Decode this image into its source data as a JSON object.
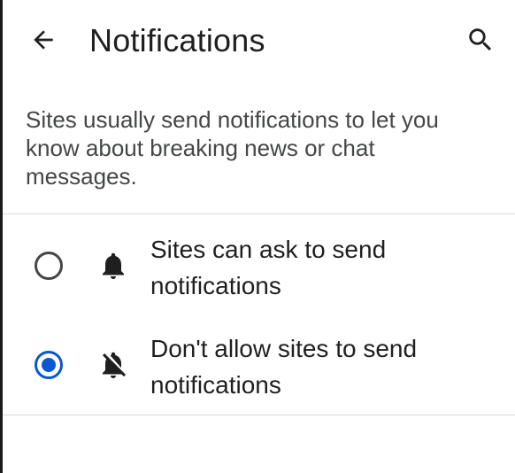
{
  "header": {
    "title": "Notifications",
    "back_icon": "arrow-back-icon",
    "search_icon": "search-icon"
  },
  "description": "Sites usually send notifications to let you know about breaking news or chat messages.",
  "options": [
    {
      "label": "Sites can ask to send notifications",
      "icon": "bell-icon",
      "selected": false
    },
    {
      "label": "Don't allow sites to send notifications",
      "icon": "bell-off-icon",
      "selected": true
    }
  ],
  "colors": {
    "accent": "#0b57d0",
    "text_primary": "#1f1f1f",
    "text_secondary": "#444746",
    "divider": "#dadce0"
  }
}
